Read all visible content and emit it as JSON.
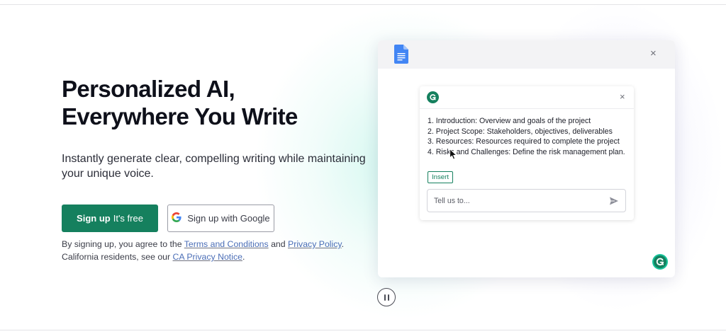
{
  "hero": {
    "title_line1": "Personalized AI,",
    "title_line2": "Everywhere You Write",
    "subtitle": "Instantly generate clear, compelling writing while maintaining your unique voice."
  },
  "cta": {
    "signup_label": "Sign up",
    "signup_suffix": "It's free",
    "google_label": "Sign up with Google"
  },
  "legal": {
    "text1": "By signing up, you agree to the ",
    "terms_link": "Terms and Conditions",
    "text2": " and ",
    "privacy_link": "Privacy Policy",
    "text3": ".",
    "text4": "California residents, see our ",
    "ca_link": "CA Privacy Notice",
    "text5": "."
  },
  "demo": {
    "window_close": "×",
    "assistant": {
      "close": "×",
      "items": [
        "1. Introduction: Overview and goals of the project",
        "2. Project Scope: Stakeholders, objectives, deliverables",
        "3. Resources: Resources required to complete the project",
        "4. Risks and Challenges: Define the risk management plan."
      ],
      "insert_label": "Insert",
      "prompt_placeholder": "Tell us to..."
    }
  },
  "icons": {
    "docs": "google-docs-icon",
    "grammarly": "grammarly-icon",
    "google": "google-g-icon",
    "send": "send-icon",
    "pause": "pause-icon",
    "cursor": "mouse-cursor-icon"
  },
  "colors": {
    "brand_green": "#15805e",
    "link_blue": "#4a6db6",
    "docs_blue": "#4285f4"
  }
}
